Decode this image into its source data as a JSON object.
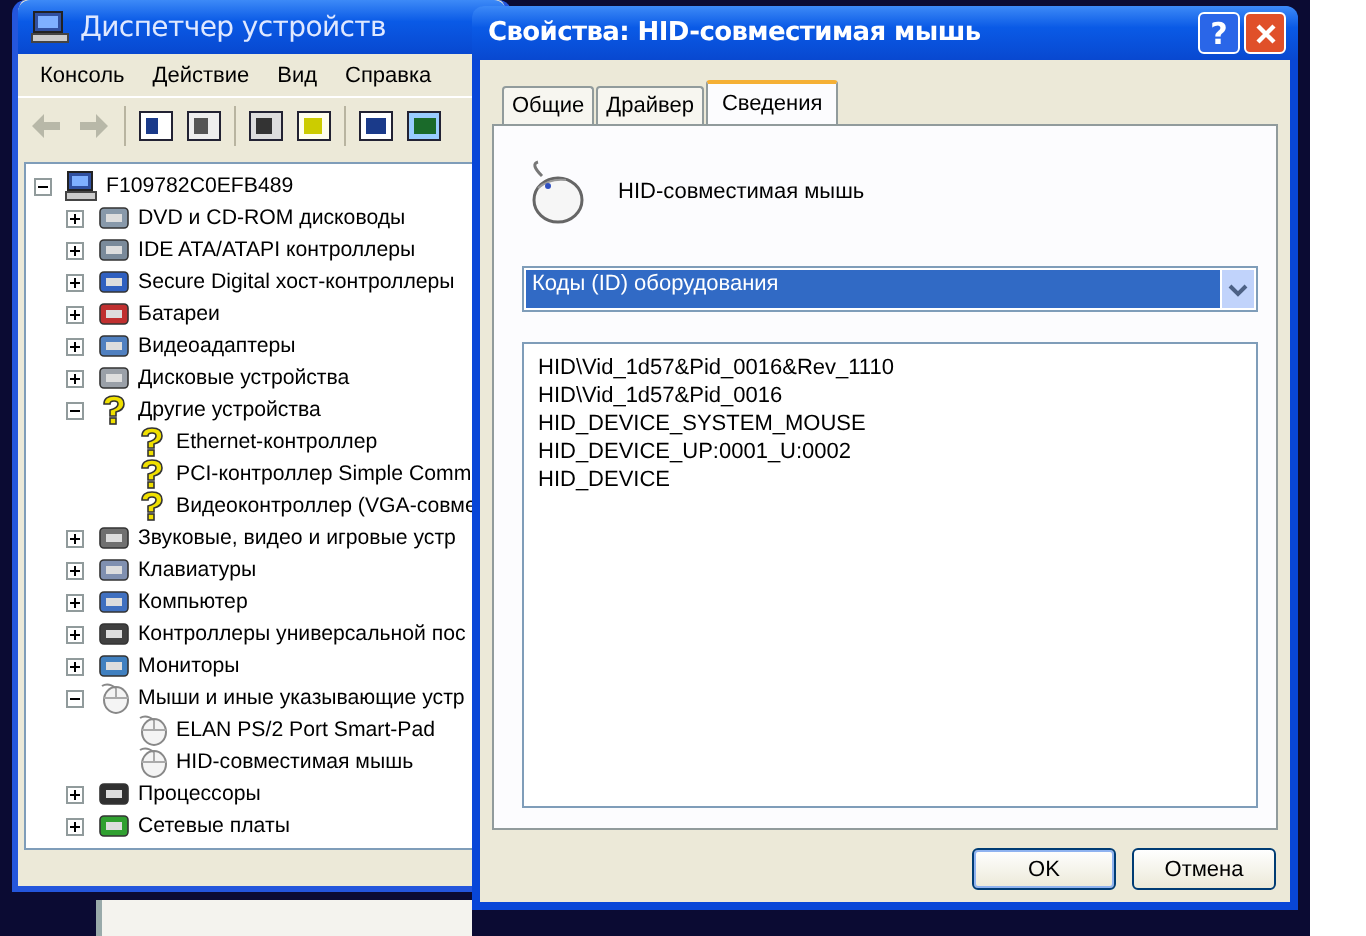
{
  "device_manager": {
    "title": "Диспетчер устройств",
    "menu": [
      "Консоль",
      "Действие",
      "Вид",
      "Справка"
    ],
    "toolbar": [
      {
        "disabled": true
      },
      {
        "disabled": true
      },
      {
        "disabled": false
      },
      {
        "disabled": false
      },
      {
        "disabled": false
      },
      {
        "disabled": false
      },
      {
        "disabled": false
      },
      {
        "disabled": false
      }
    ],
    "tree": {
      "label": "F109782C0EFB489",
      "expanded": true,
      "children": [
        {
          "label": "DVD и CD-ROM дисководы",
          "expanded": false
        },
        {
          "label": "IDE ATA/ATAPI контроллеры",
          "expanded": false
        },
        {
          "label": "Secure Digital хост-контроллеры",
          "expanded": false
        },
        {
          "label": "Батареи",
          "expanded": false
        },
        {
          "label": "Видеоадаптеры",
          "expanded": false
        },
        {
          "label": "Дисковые устройства",
          "expanded": false
        },
        {
          "label": "Другие устройства",
          "expanded": true,
          "problem": true,
          "children": [
            {
              "label": "Ethernet-контроллер",
              "problem": true
            },
            {
              "label": "PCI-контроллер Simple Comm",
              "problem": true
            },
            {
              "label": "Видеоконтроллер (VGA-совме",
              "problem": true
            }
          ]
        },
        {
          "label": "Звуковые, видео и игровые устр",
          "expanded": false
        },
        {
          "label": "Клавиатуры",
          "expanded": false
        },
        {
          "label": "Компьютер",
          "expanded": false
        },
        {
          "label": "Контроллеры универсальной пос",
          "expanded": false
        },
        {
          "label": "Мониторы",
          "expanded": false
        },
        {
          "label": "Мыши и иные указывающие устр",
          "expanded": true,
          "children": [
            {
              "label": "ELAN PS/2 Port Smart-Pad",
              "problem": false
            },
            {
              "label": "HID-совместимая мышь",
              "problem": false
            }
          ]
        },
        {
          "label": "Процессоры",
          "expanded": false
        },
        {
          "label": "Сетевые платы",
          "expanded": false
        }
      ]
    }
  },
  "dialog": {
    "title": "Свойства: HID-совместимая мышь",
    "help_button": "?",
    "tabs": [
      {
        "label": "Общие",
        "selected": false
      },
      {
        "label": "Драйвер",
        "selected": false
      },
      {
        "label": "Сведения",
        "selected": true
      }
    ],
    "device_name": "HID-совместимая мышь",
    "property_dropdown": {
      "value": "Коды (ID) оборудования"
    },
    "values": [
      "HID\\Vid_1d57&Pid_0016&Rev_1110",
      "HID\\Vid_1d57&Pid_0016",
      "HID_DEVICE_SYSTEM_MOUSE",
      "HID_DEVICE_UP:0001_U:0002",
      "HID_DEVICE"
    ],
    "buttons": [
      {
        "label": "OK",
        "kind": "default"
      },
      {
        "label": "Отмена",
        "kind": "normal"
      }
    ]
  }
}
